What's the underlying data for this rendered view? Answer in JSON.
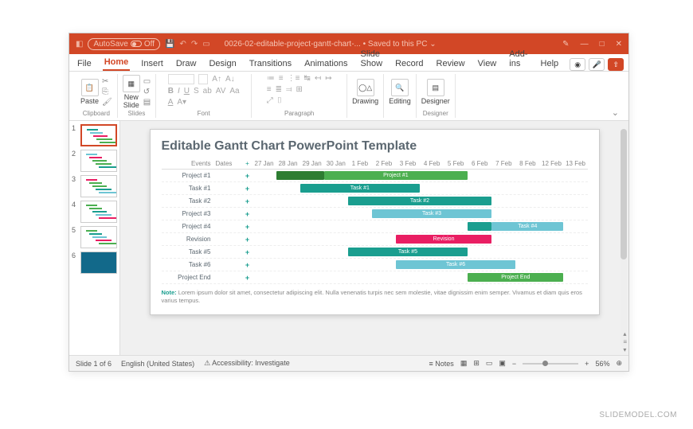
{
  "titlebar": {
    "autosave_label": "AutoSave",
    "autosave_state": "Off",
    "filename": "0026-02-editable-project-gantt-chart-...",
    "saved_label": "• Saved to this PC",
    "dropdown": "⌄"
  },
  "tabs": [
    "File",
    "Home",
    "Insert",
    "Draw",
    "Design",
    "Transitions",
    "Animations",
    "Slide Show",
    "Record",
    "Review",
    "View",
    "Add-ins",
    "Help"
  ],
  "active_tab": 1,
  "ribbon": {
    "paste": "Paste",
    "newslide": "New\nSlide",
    "groups": [
      "Clipboard",
      "Slides",
      "Font",
      "Paragraph",
      "Drawing",
      "Editing",
      "Designer"
    ],
    "drawing": "Drawing",
    "editing": "Editing",
    "designer": "Designer"
  },
  "thumbs": [
    1,
    2,
    3,
    4,
    5,
    6
  ],
  "selected_thumb": 1,
  "chart_data": {
    "type": "gantt",
    "title": "Editable Gantt Chart PowerPoint Template",
    "columns": {
      "events": "Events",
      "dates": "Dates"
    },
    "date_axis": [
      "27 Jan",
      "28 Jan",
      "29 Jan",
      "30 Jan",
      "1 Feb",
      "2 Feb",
      "3 Feb",
      "4 Feb",
      "5 Feb",
      "6 Feb",
      "7 Feb",
      "8 Feb",
      "12 Feb",
      "13 Feb"
    ],
    "rows": [
      {
        "label": "Project #1",
        "bars": [
          {
            "start": 1,
            "span": 2,
            "color": "#2e7d32",
            "label": ""
          },
          {
            "start": 3,
            "span": 6,
            "color": "#4caf50",
            "label": "Project #1"
          }
        ]
      },
      {
        "label": "Task #1",
        "bars": [
          {
            "start": 2,
            "span": 5,
            "color": "#1a9e8f",
            "label": "Task #1"
          }
        ]
      },
      {
        "label": "Task #2",
        "bars": [
          {
            "start": 4,
            "span": 6,
            "color": "#1a9e8f",
            "label": "Task #2"
          }
        ]
      },
      {
        "label": "Project #3",
        "bars": [
          {
            "start": 5,
            "span": 5,
            "color": "#6ec5d4",
            "label": "Task #3"
          }
        ]
      },
      {
        "label": "Project #4",
        "bars": [
          {
            "start": 9,
            "span": 1,
            "color": "#1a9e8f",
            "label": ""
          },
          {
            "start": 10,
            "span": 3,
            "color": "#6ec5d4",
            "label": "Task #4"
          }
        ]
      },
      {
        "label": "Revision",
        "bars": [
          {
            "start": 6,
            "span": 4,
            "color": "#e91e63",
            "label": "Revision"
          }
        ]
      },
      {
        "label": "Task #5",
        "bars": [
          {
            "start": 4,
            "span": 5,
            "color": "#1a9e8f",
            "label": "Task #5"
          }
        ]
      },
      {
        "label": "Task #6",
        "bars": [
          {
            "start": 6,
            "span": 5,
            "color": "#6ec5d4",
            "label": "Task #6"
          }
        ]
      },
      {
        "label": "Project End",
        "bars": [
          {
            "start": 9,
            "span": 4,
            "color": "#4caf50",
            "label": "Project End"
          }
        ]
      }
    ],
    "note_label": "Note:",
    "note_text": " Lorem ipsum dolor sit amet, consectetur adipiscing elit. Nulla venenatis turpis nec sem molestie, vitae dignissim enim semper. Vivamus et diam quis eros varius tempus."
  },
  "status": {
    "slide": "Slide 1 of 6",
    "lang": "English (United States)",
    "acc": "Accessibility: Investigate",
    "notes": "Notes",
    "zoom": "56%"
  },
  "watermark": "SLIDEMODEL.COM"
}
